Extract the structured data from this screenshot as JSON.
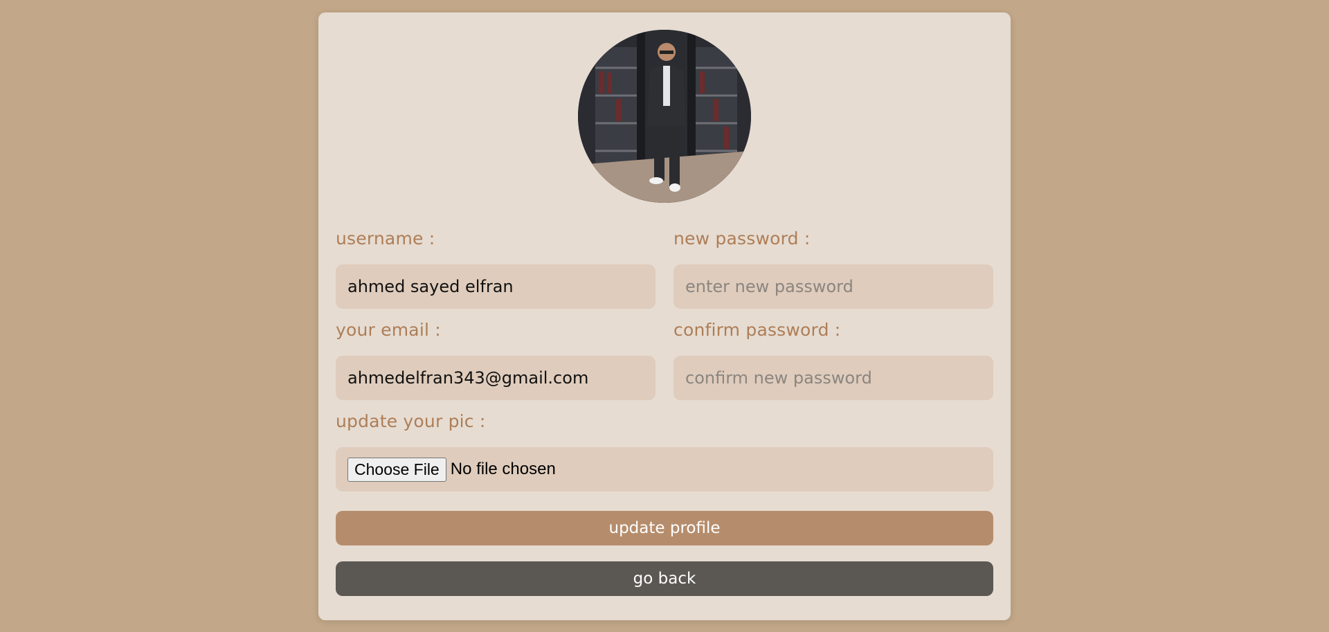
{
  "profile": {
    "avatar_alt": "profile picture"
  },
  "form": {
    "username_label": "username :",
    "username_value": "ahmed sayed elfran",
    "new_password_label": "new password :",
    "new_password_placeholder": "enter new password",
    "email_label": "your email :",
    "email_value": "ahmedelfran343@gmail.com",
    "confirm_password_label": "confirm password :",
    "confirm_password_placeholder": "confirm new password",
    "pic_label": "update your pic :",
    "file_button_label": "Choose File",
    "file_status": "No file chosen"
  },
  "actions": {
    "update_label": "update profile",
    "back_label": "go back"
  },
  "colors": {
    "page_bg": "#c2a788",
    "card_bg": "#e6dcd2",
    "label": "#ae7e57",
    "input_bg": "#dfccbc",
    "primary_button": "#b68d6c",
    "secondary_button": "#5b5753"
  }
}
